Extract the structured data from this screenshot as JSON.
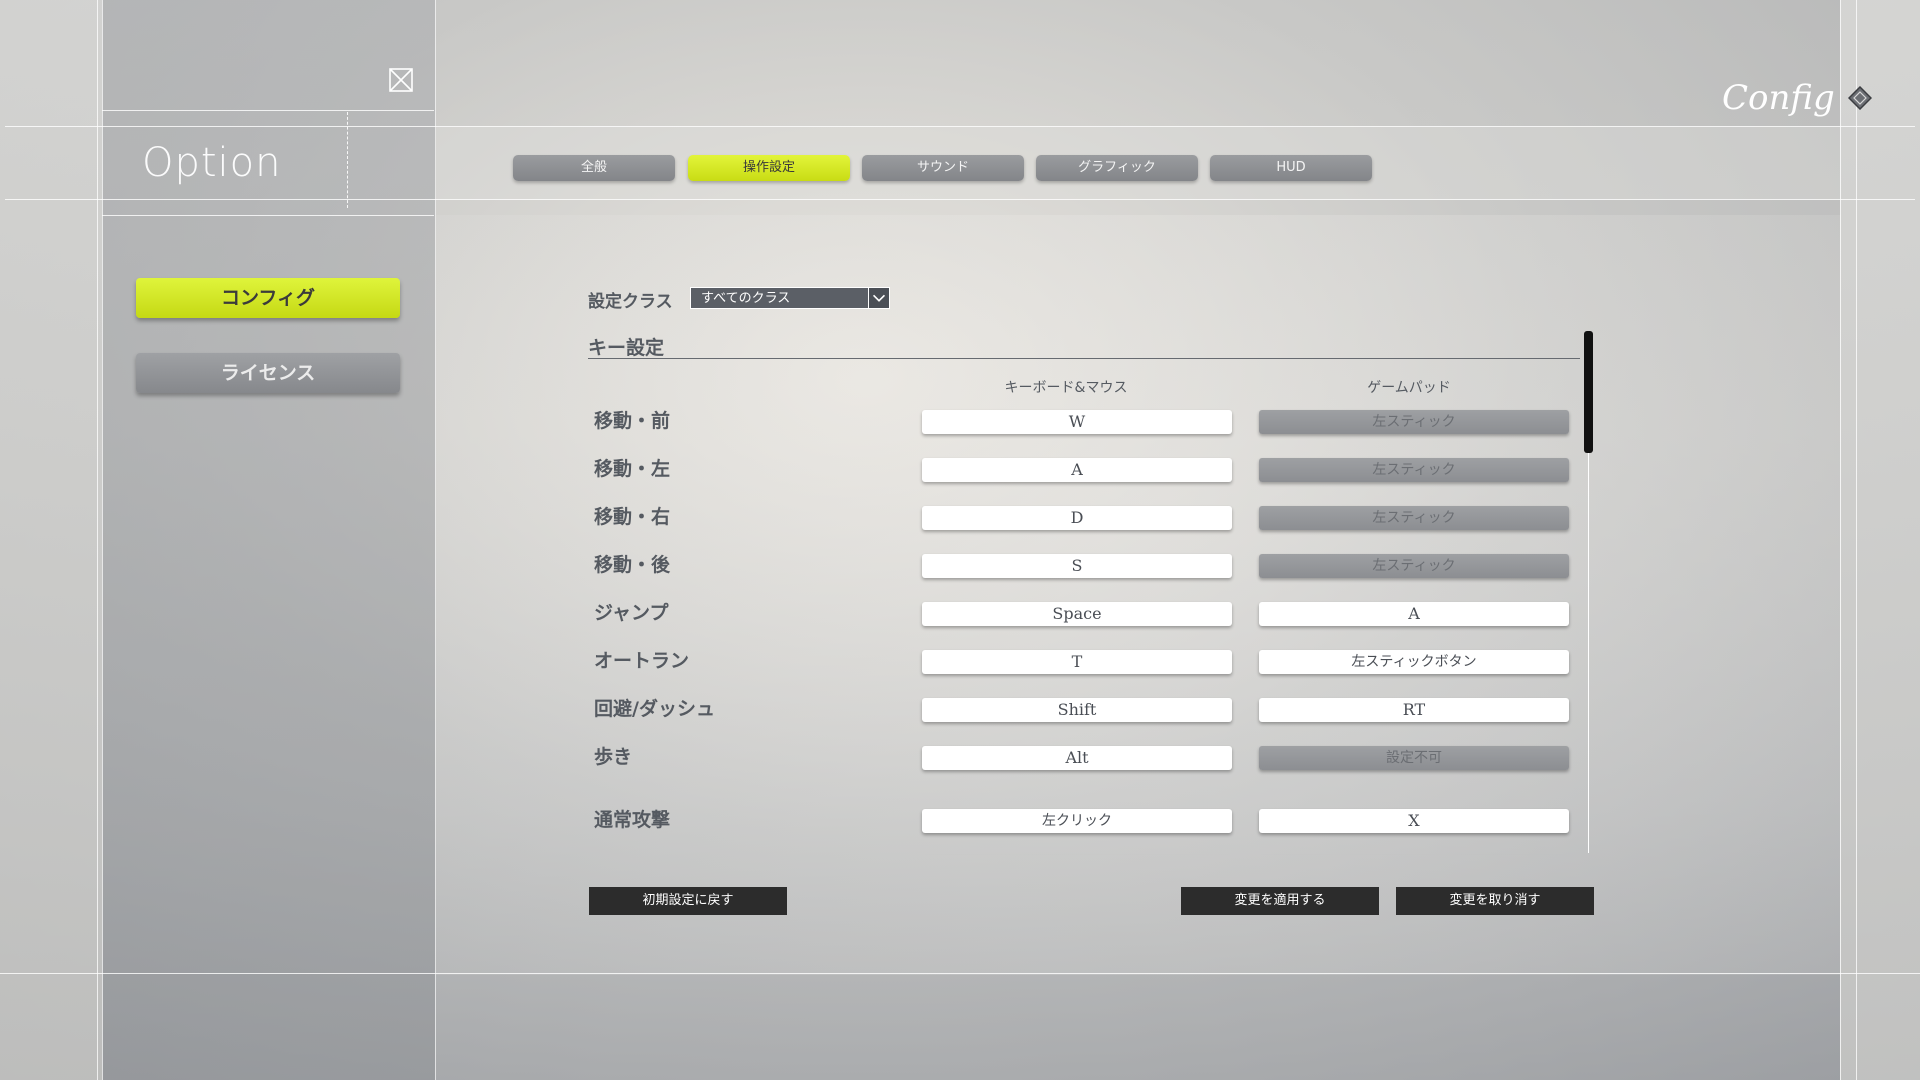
{
  "header": {
    "option_title": "Option",
    "config_label": "Config"
  },
  "tabs": [
    {
      "label": "全般",
      "active": false
    },
    {
      "label": "操作設定",
      "active": true
    },
    {
      "label": "サウンド",
      "active": false
    },
    {
      "label": "グラフィック",
      "active": false
    },
    {
      "label": "HUD",
      "active": false
    }
  ],
  "sidebar": {
    "items": [
      {
        "label": "コンフィグ",
        "active": true
      },
      {
        "label": "ライセンス",
        "active": false
      }
    ]
  },
  "class_selector": {
    "label": "設定クラス",
    "value": "すべてのクラス"
  },
  "keys": {
    "section_title": "キー設定",
    "col_keyboard": "キーボード&マウス",
    "col_gamepad": "ゲームパッド",
    "rows": [
      {
        "label": "移動・前",
        "keyboard": "W",
        "gamepad": "左スティック",
        "gamepad_disabled": true
      },
      {
        "label": "移動・左",
        "keyboard": "A",
        "gamepad": "左スティック",
        "gamepad_disabled": true
      },
      {
        "label": "移動・右",
        "keyboard": "D",
        "gamepad": "左スティック",
        "gamepad_disabled": true
      },
      {
        "label": "移動・後",
        "keyboard": "S",
        "gamepad": "左スティック",
        "gamepad_disabled": true
      },
      {
        "label": "ジャンプ",
        "keyboard": "Space",
        "gamepad": "A",
        "gamepad_disabled": false
      },
      {
        "label": "オートラン",
        "keyboard": "T",
        "gamepad": "左スティックボタン",
        "gamepad_disabled": false
      },
      {
        "label": "回避/ダッシュ",
        "keyboard": "Shift",
        "gamepad": "RT",
        "gamepad_disabled": false
      },
      {
        "label": "歩き",
        "keyboard": "Alt",
        "gamepad": "設定不可",
        "gamepad_disabled": true
      },
      {
        "label": "通常攻撃",
        "keyboard": "左クリック",
        "gamepad": "X",
        "gamepad_disabled": false
      }
    ]
  },
  "footer": {
    "reset_label": "初期設定に戻す",
    "apply_label": "変更を適用する",
    "cancel_label": "変更を取り消す"
  },
  "colors": {
    "accent": "#d6e824",
    "button_dark": "#2c2c2c",
    "text": "#555a61"
  }
}
